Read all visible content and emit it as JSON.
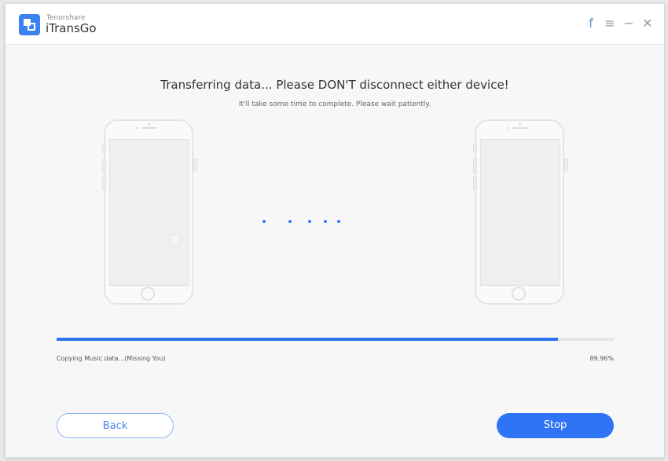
{
  "header": {
    "brand": "Tenorshare",
    "app_name": "iTransGo",
    "icons": {
      "facebook": "f",
      "menu": "≡",
      "minimize": "−",
      "close": "✕"
    }
  },
  "main": {
    "title": "Transferring data... Please DON'T disconnect either device!",
    "subtitle": "It'll take some time to complete. Please wait patiently.",
    "source_device": "source-phone",
    "target_device": "target-phone"
  },
  "progress": {
    "percent_value": 89.96,
    "percent_label": "89.96%",
    "status_text": "Copying Music data...(Missing You)"
  },
  "buttons": {
    "back_label": "Back",
    "stop_label": "Stop"
  },
  "colors": {
    "accent": "#2f74f5",
    "progress_track": "#e5e5e5"
  }
}
